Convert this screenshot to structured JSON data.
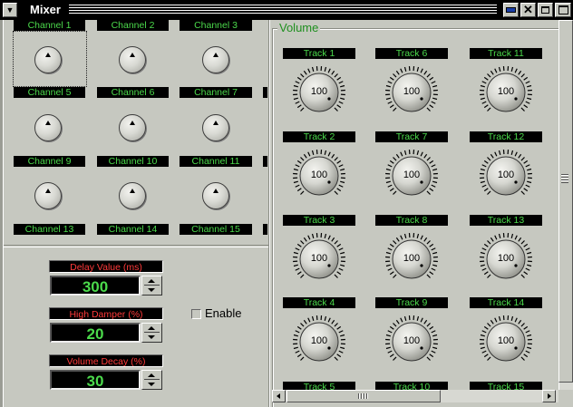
{
  "window": {
    "title": "Mixer",
    "menu_icon": "down-triangle-icon",
    "buttons": [
      "minimize-icon",
      "close-icon",
      "restore-icon",
      "maximize-icon"
    ],
    "close_glyph": "✕"
  },
  "channels": {
    "rows": [
      [
        "Channel 1",
        "Channel 2",
        "Channel 3"
      ],
      [
        "Channel 5",
        "Channel 6",
        "Channel 7"
      ],
      [
        "Channel 9",
        "Channel 10",
        "Channel 11"
      ],
      [
        "Channel 13",
        "Channel 14",
        "Channel 15"
      ]
    ]
  },
  "settings": {
    "delay": {
      "label": "Delay Value (ms)",
      "value": "300"
    },
    "damper": {
      "label": "High Damper (%)",
      "value": "20"
    },
    "decay": {
      "label": "Volume Decay (%)",
      "value": "30"
    },
    "enable_label": "Enable",
    "enable_checked": false
  },
  "volume": {
    "group_title": "Volume",
    "tracks": [
      {
        "label": "Track 1",
        "value": "100"
      },
      {
        "label": "Track 6",
        "value": "100"
      },
      {
        "label": "Track 11",
        "value": "100"
      },
      {
        "label": "Track 2",
        "value": "100"
      },
      {
        "label": "Track 7",
        "value": "100"
      },
      {
        "label": "Track 12",
        "value": "100"
      },
      {
        "label": "Track 3",
        "value": "100"
      },
      {
        "label": "Track 8",
        "value": "100"
      },
      {
        "label": "Track 13",
        "value": "100"
      },
      {
        "label": "Track 4",
        "value": "100"
      },
      {
        "label": "Track 9",
        "value": "100"
      },
      {
        "label": "Track 14",
        "value": "100"
      },
      {
        "label": "Track 5",
        "value": ""
      },
      {
        "label": "Track 10",
        "value": ""
      },
      {
        "label": "Track 15",
        "value": ""
      }
    ]
  },
  "colors": {
    "label_text": "#4bd94b",
    "alert_text": "#ff3a3a",
    "panel": "#c6c8c0",
    "group_title": "#1f8f1f"
  }
}
